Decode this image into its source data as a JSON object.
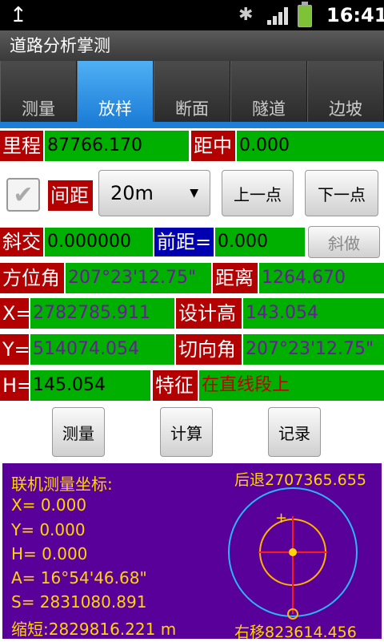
{
  "status": {
    "time": "16:41",
    "upload_icon": "upload-icon",
    "bt_icon": "bluetooth-icon"
  },
  "app": {
    "title": "道路分析掌测"
  },
  "tabs": [
    {
      "label": "测量",
      "active": false
    },
    {
      "label": "放样",
      "active": true
    },
    {
      "label": "断面",
      "active": false
    },
    {
      "label": "隧道",
      "active": false
    },
    {
      "label": "边坡",
      "active": false
    }
  ],
  "form": {
    "mileage_label": "里程",
    "mileage_value": "87766.170",
    "center_dist_label": "距中",
    "center_dist_value": "0.000",
    "interval_label": "间距",
    "interval_value": "20m",
    "prev_point": "上一点",
    "next_point": "下一点",
    "skew_label": "斜交",
    "skew_value": "0.000000",
    "front_dist_label": "前距=",
    "front_dist_value": "0.000",
    "skew_button": "斜做",
    "azimuth_label": "方位角",
    "azimuth_value": "207°23'12.75\"",
    "distance_label": "距离",
    "distance_value": "1264.670",
    "x_label": "X=",
    "x_value": "2782785.911",
    "design_h_label": "设计高",
    "design_h_value": "143.054",
    "y_label": "Y=",
    "y_value": "514074.054",
    "tangent_label": "切向角",
    "tangent_value": "207°23'12.75\"",
    "h_label": "H=",
    "h_value": "145.054",
    "feature_label": "特征",
    "feature_value": "在直线段上"
  },
  "actions": {
    "measure": "测量",
    "calculate": "计算",
    "record": "记录"
  },
  "online": {
    "title": "联机测量坐标:",
    "x": "X= 0.000",
    "y": "Y= 0.000",
    "h": "H= 0.000",
    "a": "A= 16°54'46.68\"",
    "s": "S= 2831080.891",
    "short": "缩短:2829816.221 m",
    "back": "后退2707365.655",
    "right": "右移823614.456"
  },
  "colors": {
    "accent": "#1d7ed8",
    "label_bg": "#b30000",
    "value_bg": "#00b000",
    "panel_bg": "#5a009a",
    "panel_text": "#ffd400"
  }
}
